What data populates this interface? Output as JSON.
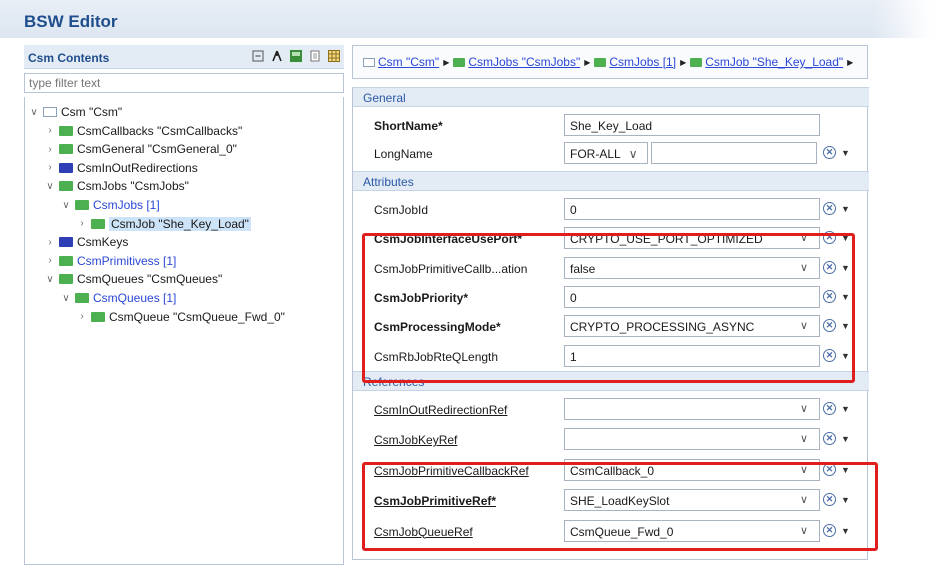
{
  "window": {
    "title": "BSW Editor"
  },
  "left": {
    "header": "Csm Contents",
    "filter_placeholder": "type filter text",
    "tree": [
      {
        "label": "Csm \"Csm\"",
        "twisty": "v",
        "icon": "outline",
        "indent": 0,
        "link": false,
        "selected": false
      },
      {
        "label": "CsmCallbacks \"CsmCallbacks\"",
        "twisty": ">",
        "icon": "green",
        "indent": 1,
        "link": false,
        "selected": false
      },
      {
        "label": "CsmGeneral \"CsmGeneral_0\"",
        "twisty": ">",
        "icon": "green",
        "indent": 1,
        "link": false,
        "selected": false
      },
      {
        "label": "CsmInOutRedirections",
        "twisty": ">",
        "icon": "blue",
        "indent": 1,
        "link": false,
        "selected": false
      },
      {
        "label": "CsmJobs \"CsmJobs\"",
        "twisty": "v",
        "icon": "green",
        "indent": 1,
        "link": false,
        "selected": false
      },
      {
        "label": "CsmJobs [1]",
        "twisty": "v",
        "icon": "green",
        "indent": 2,
        "link": true,
        "selected": false
      },
      {
        "label": "CsmJob \"She_Key_Load\"",
        "twisty": ">",
        "icon": "green",
        "indent": 3,
        "link": false,
        "selected": true
      },
      {
        "label": "CsmKeys",
        "twisty": ">",
        "icon": "blue",
        "indent": 1,
        "link": false,
        "selected": false
      },
      {
        "label": "CsmPrimitivess [1]",
        "twisty": ">",
        "icon": "green",
        "indent": 1,
        "link": true,
        "selected": false
      },
      {
        "label": "CsmQueues \"CsmQueues\"",
        "twisty": "v",
        "icon": "green",
        "indent": 1,
        "link": false,
        "selected": false
      },
      {
        "label": "CsmQueues [1]",
        "twisty": "v",
        "icon": "green",
        "indent": 2,
        "link": true,
        "selected": false
      },
      {
        "label": "CsmQueue \"CsmQueue_Fwd_0\"",
        "twisty": ">",
        "icon": "green",
        "indent": 3,
        "link": false,
        "selected": false
      }
    ]
  },
  "breadcrumb": [
    {
      "label": "Csm \"Csm\"",
      "icon": "outline"
    },
    {
      "label": "CsmJobs \"CsmJobs\"",
      "icon": "green"
    },
    {
      "label": "CsmJobs [1]",
      "icon": "green"
    },
    {
      "label": "CsmJob \"She_Key_Load\"",
      "icon": "green"
    }
  ],
  "sections": {
    "general": "General",
    "attributes": "Attributes",
    "references": "References"
  },
  "general": {
    "shortname_label": "ShortName*",
    "shortname_value": "She_Key_Load",
    "longname_label": "LongName",
    "longname_lang": "FOR-ALL",
    "longname_value": ""
  },
  "attributes": [
    {
      "label": "CsmJobId",
      "value": "0",
      "bold": false,
      "select": false
    },
    {
      "label": "CsmJobInterfaceUsePort*",
      "value": "CRYPTO_USE_PORT_OPTIMIZED",
      "bold": true,
      "select": true
    },
    {
      "label": "CsmJobPrimitiveCallb...ation",
      "value": "false",
      "bold": false,
      "select": true
    },
    {
      "label": "CsmJobPriority*",
      "value": "0",
      "bold": true,
      "select": false
    },
    {
      "label": "CsmProcessingMode*",
      "value": "CRYPTO_PROCESSING_ASYNC",
      "bold": true,
      "select": true
    },
    {
      "label": "CsmRbJobRteQLength",
      "value": "1",
      "bold": false,
      "select": false
    }
  ],
  "references": [
    {
      "label": "CsmInOutRedirectionRef",
      "value": "",
      "bold": false
    },
    {
      "label": "CsmJobKeyRef",
      "value": "",
      "bold": false
    },
    {
      "label": "CsmJobPrimitiveCallbackRef",
      "value": "CsmCallback_0",
      "bold": false
    },
    {
      "label": "CsmJobPrimitiveRef*",
      "value": "SHE_LoadKeySlot",
      "bold": true
    },
    {
      "label": "CsmJobQueueRef",
      "value": "CsmQueue_Fwd_0",
      "bold": false
    }
  ],
  "colors": {
    "highlight_box": "#e01e1e",
    "link": "#2a47d8",
    "section_bg": "#e3ebf5"
  }
}
